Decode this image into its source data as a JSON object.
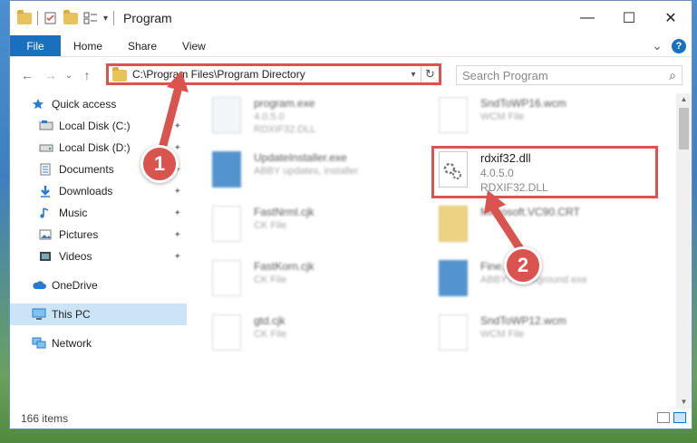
{
  "window": {
    "title": "Program",
    "controls": {
      "minimize": "—",
      "maximize": "☐",
      "close": "✕"
    }
  },
  "ribbon": {
    "tabs": [
      "File",
      "Home",
      "Share",
      "View"
    ],
    "expand_glyph": "⌄",
    "help_glyph": "?"
  },
  "nav": {
    "back": "←",
    "forward": "→",
    "recent": "⌄",
    "up": "↑",
    "address": "C:\\Program Files\\Program Directory",
    "dropdown": "▾",
    "refresh": "↻",
    "search_placeholder": "Search Program",
    "search_glyph": "⌕"
  },
  "sidebar": {
    "quick_access": "Quick access",
    "items": [
      {
        "label": "Local Disk (C:)",
        "icon": "drive-icon"
      },
      {
        "label": "Local Disk (D:)",
        "icon": "drive-icon"
      },
      {
        "label": "Documents",
        "icon": "documents-icon"
      },
      {
        "label": "Downloads",
        "icon": "downloads-icon"
      },
      {
        "label": "Music",
        "icon": "music-icon"
      },
      {
        "label": "Pictures",
        "icon": "pictures-icon"
      },
      {
        "label": "Videos",
        "icon": "videos-icon"
      }
    ],
    "pin_glyph": "📌",
    "onedrive": "OneDrive",
    "this_pc": "This PC",
    "network": "Network"
  },
  "files": [
    {
      "name": "program.exe",
      "line1": "4.0.5.0",
      "line2": "RDXIF32.DLL"
    },
    {
      "name": "SndToWP16.wcm",
      "line1": "WCM File",
      "line2": ""
    },
    {
      "name": "UpdateInstaller.exe",
      "line1": "ABBY updates, installer",
      "line2": ""
    },
    {
      "name": "rdxif32.dll",
      "line1": "4.0.5.0",
      "line2": "RDXIF32.DLL"
    },
    {
      "name": "FastNrml.cjk",
      "line1": "CK File",
      "line2": ""
    },
    {
      "name": "Microsoft.VC90.CRT",
      "line1": "",
      "line2": ""
    },
    {
      "name": "FastKorn.cjk",
      "line1": "CK File",
      "line2": ""
    },
    {
      "name": "Fine...exe",
      "line1": "ABBYY background exe",
      "line2": ""
    },
    {
      "name": "gtd.cjk",
      "line1": "CK File",
      "line2": ""
    },
    {
      "name": "SndToWP12.wcm",
      "line1": "WCM File",
      "line2": ""
    }
  ],
  "status": {
    "count": "166 items"
  },
  "annotations": {
    "step1": "1",
    "step2": "2"
  },
  "colors": {
    "accent": "#1a6fbe",
    "highlight": "#d9534f",
    "selection": "#cce4f7"
  }
}
